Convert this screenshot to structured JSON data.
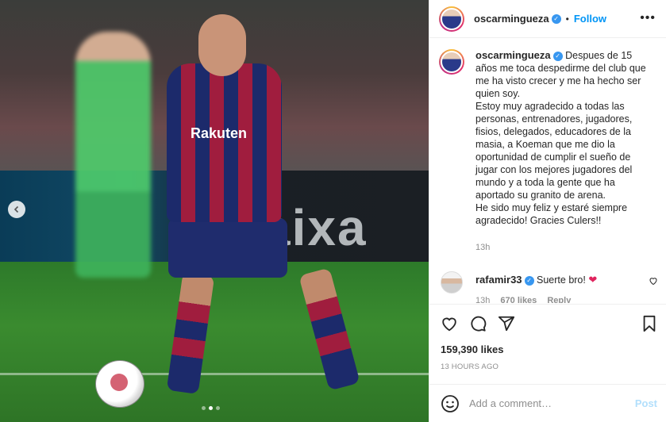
{
  "post": {
    "author": "oscarmingueza",
    "follow_label": "Follow",
    "separator": "•",
    "more_label": "•••",
    "photo_text": {
      "sponsor": "Rakuten",
      "banner": "aixa"
    },
    "caption": {
      "username": "oscarmingueza",
      "text_1": " Despues de 15 años me toca despedirme del club que me ha visto crecer y me ha hecho ser quien soy.",
      "text_2": "Estoy muy agradecido a todas las personas, entrenadores, jugadores, fisios, delegados, educadores de la masia, a Koeman que me dio la oportunidad de cumplir el sueño de jugar con los mejores jugadores del mundo y a toda la gente que ha aportado su granito de arena.",
      "text_3": "He sido muy feliz y estaré siempre agradecido! Gracies Culers!!",
      "time": "13h"
    },
    "comment": {
      "username": "rafamir33",
      "text": " Suerte bro! ",
      "emoji": "❤",
      "time": "13h",
      "likes": "670 likes",
      "reply": "Reply"
    },
    "likes_count": "159,390 likes",
    "date": "13 HOURS AGO",
    "add_comment_placeholder": "Add a comment…",
    "post_button": "Post",
    "carousel": {
      "current_slide": 2,
      "total_slides": 3
    }
  },
  "colors": {
    "accent": "#0095f6",
    "verified": "#3897f0",
    "heart": "#e0245e",
    "muted": "#8e8e8e"
  }
}
